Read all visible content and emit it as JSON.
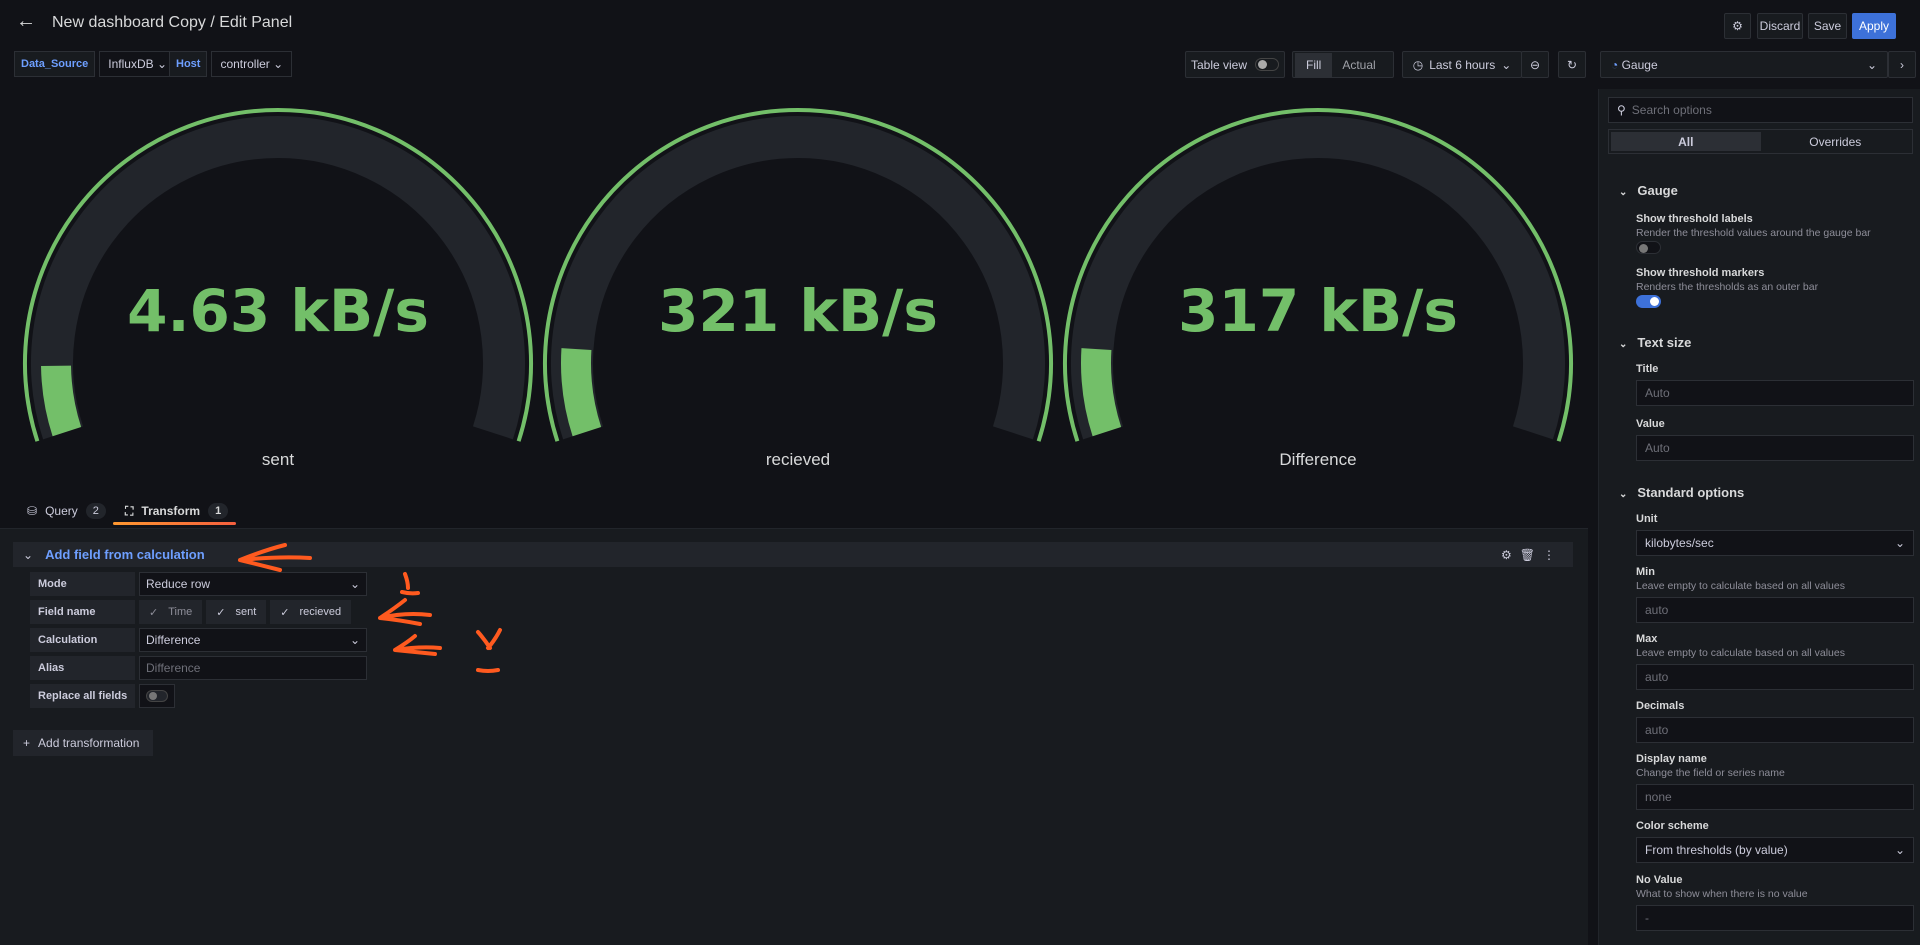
{
  "header": {
    "title": "New dashboard Copy / Edit Panel",
    "discard": "Discard",
    "save": "Save",
    "apply": "Apply"
  },
  "variables": [
    {
      "label": "Data_Source",
      "value": "InfluxDB"
    },
    {
      "label": "Host",
      "value": "controller"
    }
  ],
  "toolbar": {
    "table_view": "Table view",
    "fill": "Fill",
    "actual": "Actual",
    "time_range": "Last 6 hours",
    "visualization": "Gauge"
  },
  "gauges": [
    {
      "value": "4.63 kB/s",
      "label": "sent",
      "fill_fraction": 0.08
    },
    {
      "value": "321 kB/s",
      "label": "recieved",
      "fill_fraction": 0.1
    },
    {
      "value": "317 kB/s",
      "label": "Difference",
      "fill_fraction": 0.1
    }
  ],
  "colors": {
    "green": "#73bf69",
    "accent": "#3d71d9",
    "annotation": "#ff5a1f"
  },
  "tabs": [
    {
      "label": "Query",
      "count": "2"
    },
    {
      "label": "Transform",
      "count": "1"
    }
  ],
  "transform": {
    "title": "Add field from calculation",
    "mode_label": "Mode",
    "mode": "Reduce row",
    "field_label": "Field name",
    "fields": [
      "Time",
      "sent",
      "recieved"
    ],
    "calc_label": "Calculation",
    "calc": "Difference",
    "alias_label": "Alias",
    "alias_placeholder": "Difference",
    "replace_label": "Replace all fields",
    "add": "Add transformation"
  },
  "options": {
    "search_placeholder": "Search options",
    "all": "All",
    "overrides": "Overrides",
    "gauge_section": "Gauge",
    "thr_labels": "Show threshold labels",
    "thr_labels_desc": "Render the threshold values around the gauge bar",
    "thr_markers": "Show threshold markers",
    "thr_markers_desc": "Renders the thresholds as an outer bar",
    "text_size": "Text size",
    "title": "Title",
    "title_ph": "Auto",
    "value": "Value",
    "value_ph": "Auto",
    "standard": "Standard options",
    "unit": "Unit",
    "unit_val": "kilobytes/sec",
    "min": "Min",
    "min_desc": "Leave empty to calculate based on all values",
    "min_ph": "auto",
    "max": "Max",
    "max_desc": "Leave empty to calculate based on all values",
    "max_ph": "auto",
    "decimals": "Decimals",
    "decimals_ph": "auto",
    "display_name": "Display name",
    "display_name_desc": "Change the field or series name",
    "display_name_ph": "none",
    "color_scheme": "Color scheme",
    "color_scheme_val": "From thresholds (by value)",
    "no_value": "No Value",
    "no_value_desc": "What to show when there is no value",
    "no_value_ph": "-"
  }
}
